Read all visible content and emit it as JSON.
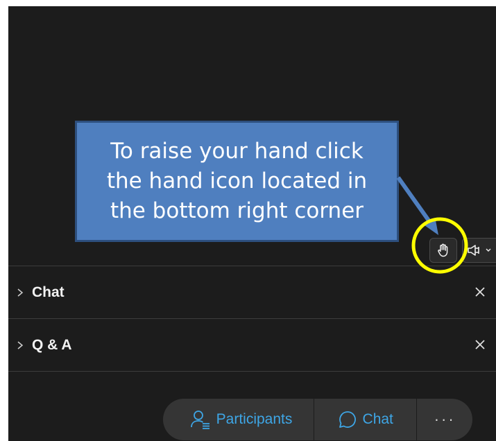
{
  "colors": {
    "background": "#1c1c1c",
    "accent": "#3ea6e6",
    "callout_fill": "#4f7fbf",
    "highlight_circle": "#ffff00"
  },
  "controls": {
    "raise_hand_icon": "raised-hand-icon",
    "speaker_icon": "speaker-icon"
  },
  "panels": [
    {
      "title": "Chat",
      "expand_icon": "chevron-right-icon",
      "close_icon": "close-icon"
    },
    {
      "title": "Q & A",
      "expand_icon": "chevron-right-icon",
      "close_icon": "close-icon"
    }
  ],
  "footer": {
    "participants_label": "Participants",
    "chat_label": "Chat",
    "more_label": "···"
  },
  "annotation": {
    "lines": [
      "To raise your hand click",
      "the hand icon located in",
      "the bottom right corner"
    ]
  }
}
